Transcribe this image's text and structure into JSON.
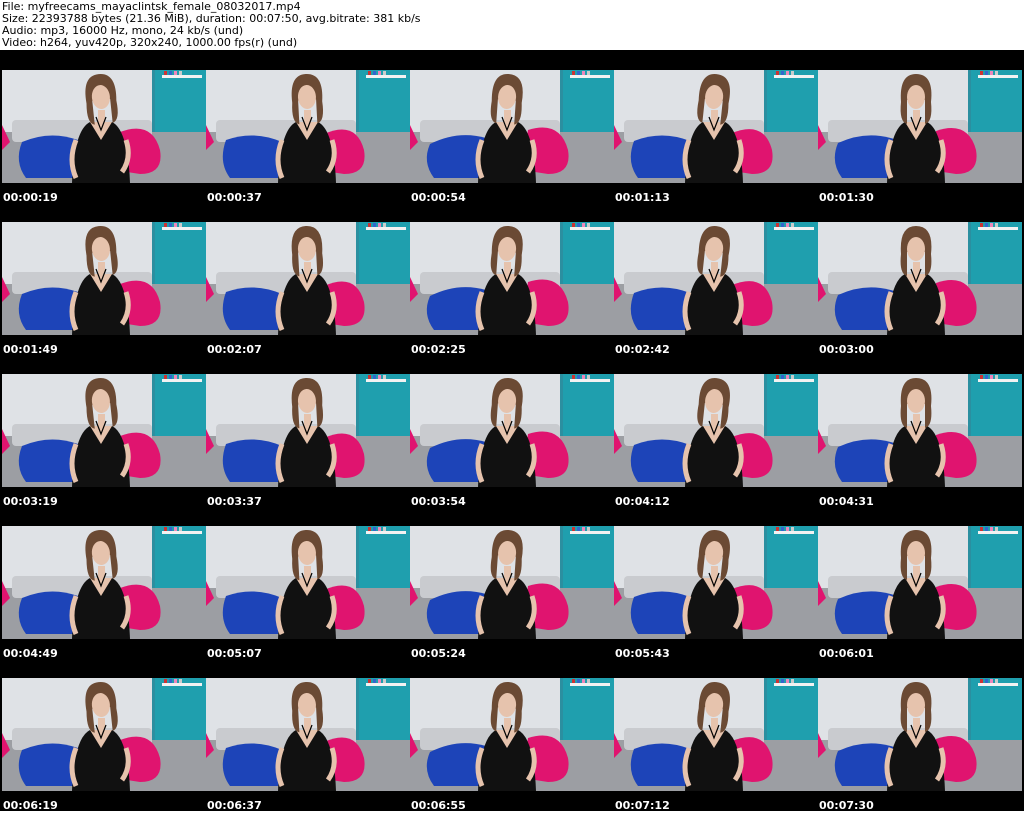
{
  "header": {
    "file": "File: myfreecams_mayaclintsk_female_08032017.mp4",
    "size": "Size: 22393788 bytes (21.36 MiB), duration: 00:07:50, avg.bitrate: 381 kb/s",
    "audio": "Audio: mp3, 16000 Hz, mono, 24 kb/s (und)",
    "video": "Video: h264, yuv420p, 320x240, 1000.00 fps(r) (und)"
  },
  "colors": {
    "sheet_background": "#000000",
    "wall": "#dfe2e6",
    "teal_wall": "#1f9fae",
    "blue_pillow": "#1d44b8",
    "pink_pillow": "#e0146f",
    "sofa": "#9c9ea3",
    "hair": "#6b4a34",
    "skin": "#e6c3ad",
    "dress": "#111111"
  },
  "thumbnails": [
    {
      "time": "00:00:19"
    },
    {
      "time": "00:00:37"
    },
    {
      "time": "00:00:54"
    },
    {
      "time": "00:01:13"
    },
    {
      "time": "00:01:30"
    },
    {
      "time": "00:01:49"
    },
    {
      "time": "00:02:07"
    },
    {
      "time": "00:02:25"
    },
    {
      "time": "00:02:42"
    },
    {
      "time": "00:03:00"
    },
    {
      "time": "00:03:19"
    },
    {
      "time": "00:03:37"
    },
    {
      "time": "00:03:54"
    },
    {
      "time": "00:04:12"
    },
    {
      "time": "00:04:31"
    },
    {
      "time": "00:04:49"
    },
    {
      "time": "00:05:07"
    },
    {
      "time": "00:05:24"
    },
    {
      "time": "00:05:43"
    },
    {
      "time": "00:06:01"
    },
    {
      "time": "00:06:19"
    },
    {
      "time": "00:06:37"
    },
    {
      "time": "00:06:55"
    },
    {
      "time": "00:07:12"
    },
    {
      "time": "00:07:30"
    }
  ]
}
